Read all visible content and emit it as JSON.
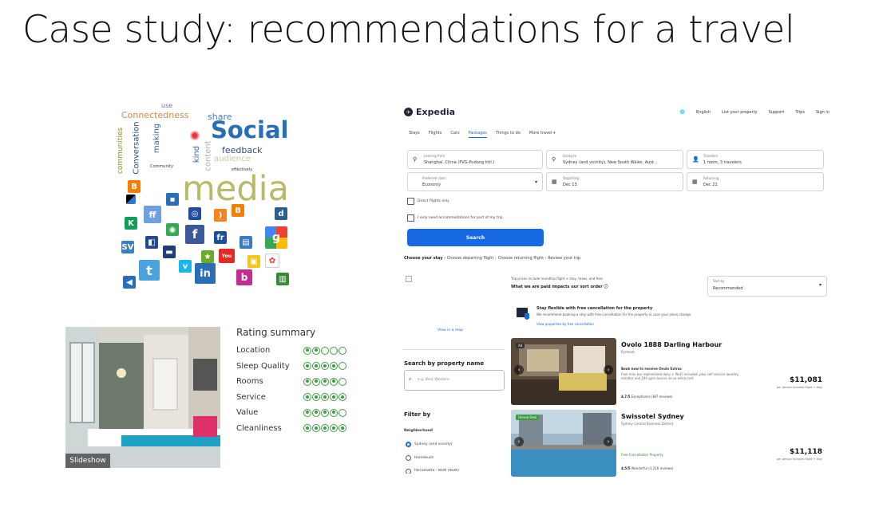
{
  "slide": {
    "title": "Case study: recommendations for a travel"
  },
  "word_cloud": {
    "words": [
      "Social",
      "media",
      "feedback",
      "share",
      "Connectedness",
      "Conversation",
      "making",
      "communities",
      "kind",
      "content",
      "audience",
      "use",
      "Community",
      "effectively"
    ]
  },
  "hotel_photo": {
    "slideshow_label": "Slideshow"
  },
  "rating_summary": {
    "heading": "Rating summary",
    "items": [
      {
        "label": "Location",
        "filled": 2
      },
      {
        "label": "Sleep Quality",
        "filled": 4
      },
      {
        "label": "Rooms",
        "filled": 4
      },
      {
        "label": "Service",
        "filled": 5
      },
      {
        "label": "Value",
        "filled": 4
      },
      {
        "label": "Cleanliness",
        "filled": 5
      }
    ]
  },
  "expedia": {
    "brand": "Expedia",
    "nav": [
      "English",
      "List your property",
      "Support",
      "Trips",
      "Sign in"
    ],
    "tabs": [
      "Stays",
      "Flights",
      "Cars",
      "Packages",
      "Things to do",
      "More travel"
    ],
    "active_tab": "Packages",
    "leaving_from": {
      "caption": "Leaving from",
      "value": "Shanghai, China (PVG-Pudong Intl.)"
    },
    "going_to": {
      "caption": "Going to",
      "value": "Sydney (and vicinity), New South Wales, Aust..."
    },
    "travelers": {
      "caption": "Travelers",
      "value": "1 room, 3 travelers"
    },
    "cabin": {
      "caption": "Preferred class",
      "value": "Economy"
    },
    "departing": {
      "caption": "Departing",
      "value": "Dec 13"
    },
    "returning": {
      "caption": "Returning",
      "value": "Dec 21"
    },
    "check_direct": "Direct flights only",
    "check_partial": "I only need accommodations for part of my trip",
    "search_label": "Search",
    "breadcrumb": {
      "step1": "Choose your stay",
      "rest": " › Choose departing flight › Choose returning flight › Review your trip"
    },
    "trip_prices_note": "Trip prices include roundtrip flight + stay, taxes, and fees",
    "sort_heading": "What we are paid impacts our sort order",
    "sort": {
      "caption": "Sort by",
      "value": "Recommended"
    },
    "flex": {
      "title": "Stay flexible with free cancellation for the property",
      "body": "We recommend booking a stay with free cancellation for the property in case your plans change.",
      "link": "View properties by free cancellation"
    },
    "map_link": "View in a map",
    "search_by_name": "Search by property name",
    "name_placeholder": "e.g. Best Western",
    "filter_by": "Filter by",
    "neighborhood": "Neighborhood",
    "radios": [
      "Sydney (and vicinity)",
      "Homebush",
      "Parramatta - NSW (NSW)"
    ],
    "hotels": [
      {
        "badge": "Ad",
        "name": "Ovolo 1888 Darling Harbour",
        "location": "Pyrmont",
        "extra_title": "Book now to receive Ovolo Extras",
        "extra_body": "Free mini bar replenished daily + Wi-Fi included, plus self service laundry, minibar and 24h gym access at no extra cost",
        "rating": "4.7/5",
        "rating_text": "Exceptional (387 reviews)",
        "price": "$11,081",
        "price_note": "per person includes flight + stay"
      },
      {
        "badge": "Unreal Deal",
        "name": "Swissotel Sydney",
        "location": "Sydney Central Business District",
        "extra_title": "Free Cancellation Property",
        "extra_body": "",
        "rating": "4.5/5",
        "rating_text": "Wonderful (1,216 reviews)",
        "price": "$11,118",
        "price_note": "per person includes flight + stay"
      }
    ]
  },
  "colors": {
    "expedia_blue": "#1668e3",
    "rating_green": "#3f9b3f",
    "social_blue": "#2a6fb5",
    "media_olive": "#b9b96a"
  }
}
